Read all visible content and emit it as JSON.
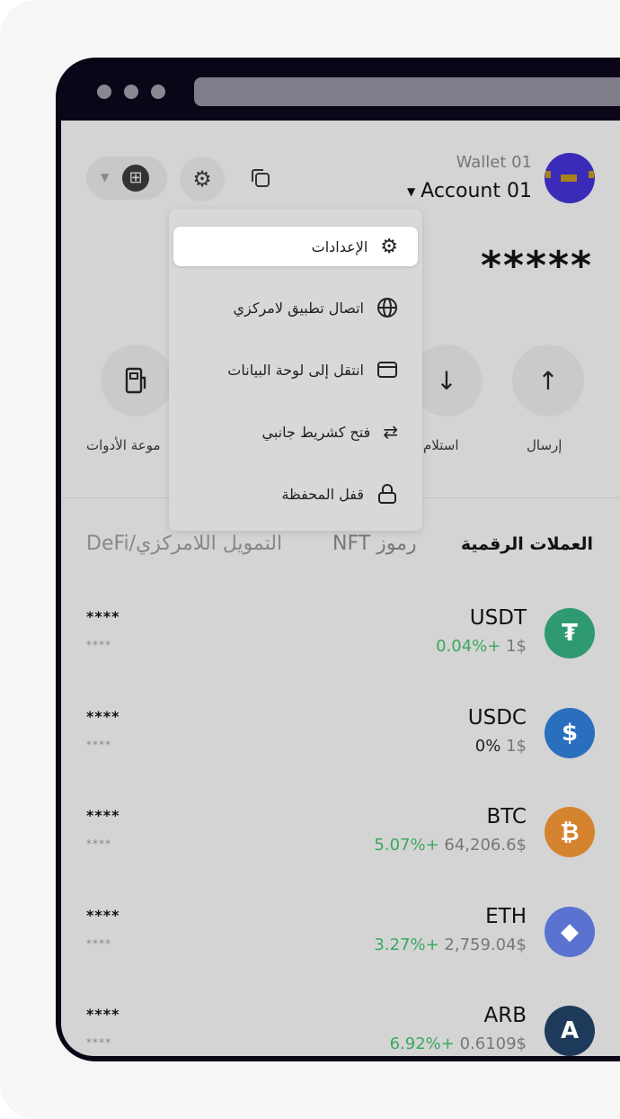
{
  "header": {
    "wallet_name": "Wallet 01",
    "account_name": "Account 01",
    "balance": "*****"
  },
  "menu": {
    "items": [
      {
        "label": "الإعدادات",
        "icon": "gear-icon",
        "selected": true
      },
      {
        "label": "اتصال تطبيق لامركزي",
        "icon": "globe-icon"
      },
      {
        "label": "انتقل إلى لوحة البيانات",
        "icon": "browser-window-icon"
      },
      {
        "label": "فتح كشريط جانبي",
        "icon": "swap-arrows-icon"
      },
      {
        "label": "قفل المحفظة",
        "icon": "lock-icon"
      }
    ]
  },
  "actions": {
    "send": "إرسال",
    "receive": "استلام",
    "tools": "موعة الأدوات"
  },
  "tabs": [
    {
      "label": "العملات الرقمية",
      "active": true
    },
    {
      "label": "رموز NFT"
    },
    {
      "label": "التمويل اللامركزي/DeFi"
    }
  ],
  "tokens": [
    {
      "symbol": "USDT",
      "price": "1$",
      "change": "0.04%+",
      "balance": "****",
      "value": "****",
      "color": "#2f9a72"
    },
    {
      "symbol": "USDC",
      "price": "1$",
      "change": "0%",
      "balance": "****",
      "value": "****",
      "color": "#2a6ebe"
    },
    {
      "symbol": "BTC",
      "price": "64,206.6$",
      "change": "5.07%+",
      "balance": "****",
      "value": "****",
      "color": "#d6832f"
    },
    {
      "symbol": "ETH",
      "price": "2,759.04$",
      "change": "3.27%+",
      "balance": "****",
      "value": "****",
      "color": "#5a72d0"
    },
    {
      "symbol": "ARB",
      "price": "0.6109$",
      "change": "6.92%+",
      "balance": "****",
      "value": "****",
      "color": "#1e3a5a"
    }
  ],
  "colors": {
    "positive": "#3aa860",
    "frame": "#0b0518"
  }
}
